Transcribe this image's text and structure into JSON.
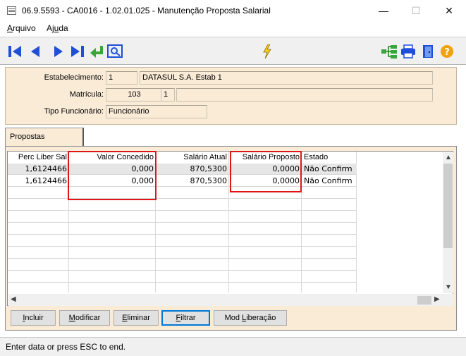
{
  "window": {
    "title": "06.9.5593 - CA0016 - 1.02.01.025 - Manutenção Proposta Salarial",
    "minimize_symbol": "—",
    "maximize_symbol": "☐",
    "close_symbol": "✕"
  },
  "menu": {
    "items": [
      "Arquivo",
      "Ajuda"
    ]
  },
  "toolbar": {
    "nav_icons": [
      "first-record-icon",
      "previous-record-icon",
      "next-record-icon",
      "last-record-icon",
      "go-to-icon",
      "search-icon"
    ],
    "center_icon": "lightning-icon",
    "right_icons": [
      "hierarchy-icon",
      "print-icon",
      "exit-door-icon",
      "help-icon"
    ]
  },
  "header": {
    "estabelecimento_label": "Estabelecimento:",
    "estabelecimento_code": "1",
    "estabelecimento_name": "DATASUL S.A. Estab 1",
    "matricula_label": "Matrícula:",
    "matricula_value": "103",
    "matricula_digit": "1",
    "matricula_name": "",
    "tipo_label": "Tipo Funcionário:",
    "tipo_value": "Funcionário"
  },
  "tab": {
    "label": "Propostas"
  },
  "grid": {
    "columns": [
      "Perc Liber Sal",
      "Valor Concedido",
      "Salário Atual",
      "Salário Proposto",
      "Estado"
    ],
    "rows": [
      [
        "1,6124466",
        "0,000",
        "870,5300",
        "0,0000",
        "Não Confirm"
      ],
      [
        "1,6124466",
        "0,000",
        "870,5300",
        "0,0000",
        "Não Confirm"
      ]
    ]
  },
  "buttons": {
    "incluir": "Incluir",
    "modificar": "Modificar",
    "eliminar": "Eliminar",
    "filtrar": "Filtrar",
    "mod_liberacao": "Mod Liberação"
  },
  "status": {
    "text": "Enter data or press ESC to end."
  },
  "colors": {
    "panel": "#faebd7",
    "highlight": "#e01616",
    "nav_blue": "#1e4fd6"
  }
}
